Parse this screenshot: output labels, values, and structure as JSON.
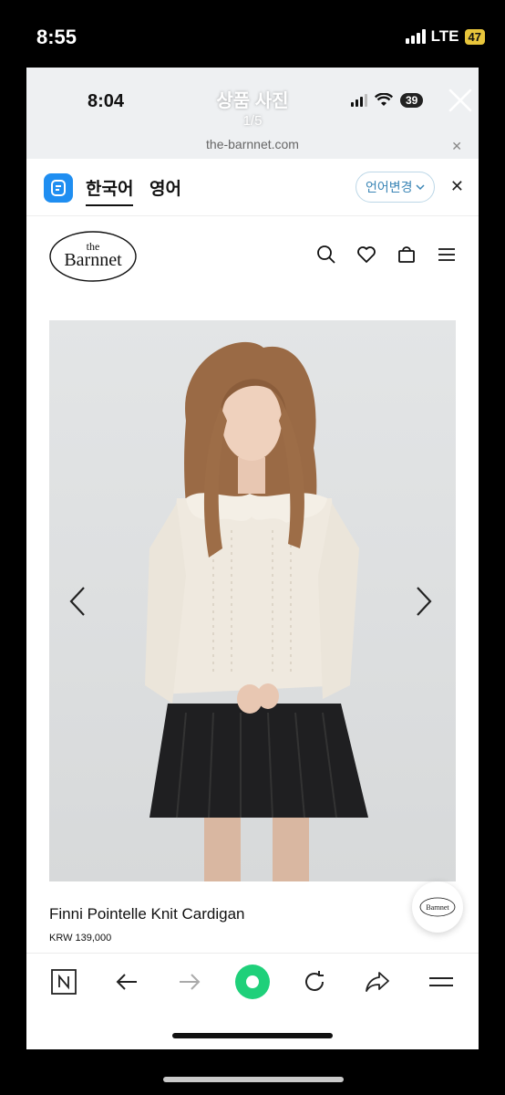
{
  "outer_status": {
    "time": "8:55",
    "network": "LTE",
    "battery": "47"
  },
  "inner_status": {
    "time": "8:04",
    "battery": "39"
  },
  "viewer": {
    "title": "상품 사진",
    "counter": "1/5"
  },
  "browser": {
    "url": "the-barnnet.com"
  },
  "translate_bar": {
    "lang_from": "한국어",
    "lang_to": "영어",
    "change_label": "언어변경"
  },
  "site": {
    "logo_text_top": "the",
    "logo_text_main": "Barnnet"
  },
  "product": {
    "name": "Finni Pointelle Knit Cardigan",
    "price": "KRW 139,000"
  },
  "colors": {
    "accent_green": "#1fd07a",
    "battery_yellow": "#e8c53b",
    "papago_blue": "#1f8ef1"
  },
  "icons": [
    "search-icon",
    "heart-icon",
    "bag-icon",
    "menu-icon",
    "chevron-left-icon",
    "chevron-right-icon",
    "back-icon",
    "forward-icon",
    "reload-icon",
    "share-icon"
  ]
}
